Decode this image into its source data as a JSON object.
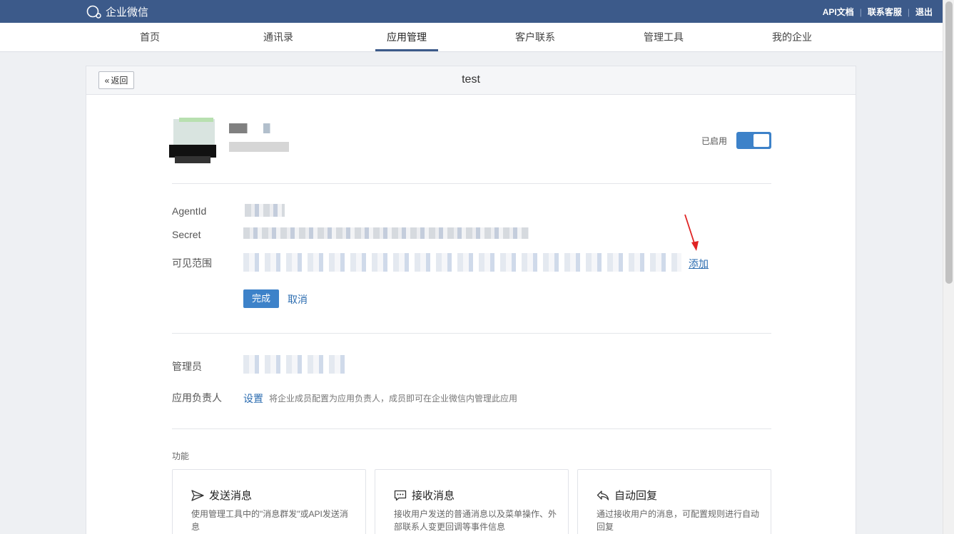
{
  "topbar": {
    "logo_text": "企业微信",
    "links": [
      "API文档",
      "联系客服",
      "退出"
    ],
    "separator": "|"
  },
  "nav": {
    "items": [
      "首页",
      "通讯录",
      "应用管理",
      "客户联系",
      "管理工具",
      "我的企业"
    ],
    "active": "应用管理"
  },
  "card": {
    "back_label": "返回",
    "title": "test"
  },
  "app": {
    "status_label": "已启用",
    "enabled": true
  },
  "fields": {
    "agentid_label": "AgentId",
    "secret_label": "Secret",
    "visible_label": "可见范围",
    "add_link": "添加",
    "done_button": "完成",
    "cancel_link": "取消"
  },
  "admins": {
    "admin_label": "管理员",
    "owner_label": "应用负责人",
    "set_link": "设置",
    "hint": "将企业成员配置为应用负责人，成员即可在企业微信内管理此应用"
  },
  "features": {
    "section_label": "功能",
    "items": [
      {
        "title": "发送消息",
        "desc": "使用管理工具中的\"消息群发\"或API发送消息",
        "icon": "send-icon"
      },
      {
        "title": "接收消息",
        "desc": "接收用户发送的普通消息以及菜单操作、外部联系人变更回调等事件信息",
        "icon": "chat-icon"
      },
      {
        "title": "自动回复",
        "desc": "通过接收用户的消息，可配置规则进行自动回复",
        "icon": "reply-icon"
      }
    ]
  },
  "colors": {
    "topbar": "#3c5a8a",
    "accent": "#3d82c9",
    "link": "#2b6cb0",
    "annotation_arrow": "#e02424"
  }
}
